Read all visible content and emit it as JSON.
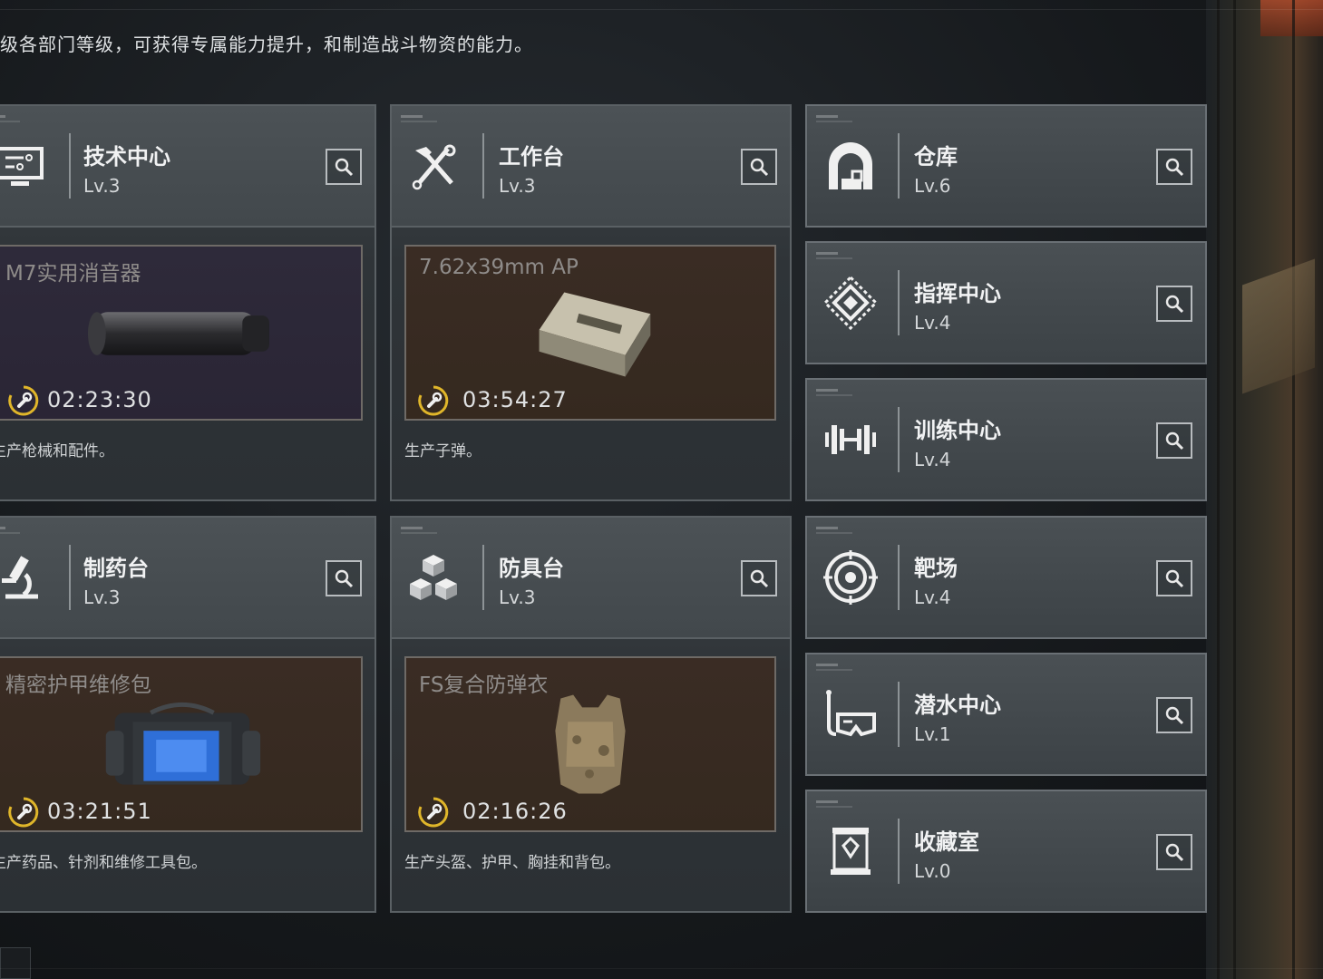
{
  "header": {
    "description": "级各部门等级，可获得专属能力提升，和制造战斗物资的能力。"
  },
  "departments": {
    "tech": {
      "name": "技术中心",
      "level": "Lv.3",
      "icon": "monitor-icon",
      "craft_item": "M7实用消音器",
      "timer": "02:23:30",
      "description": "生产枪械和配件。"
    },
    "workbench": {
      "name": "工作台",
      "level": "Lv.3",
      "icon": "hammer-wrench-icon",
      "craft_item": "7.62x39mm AP",
      "timer": "03:54:27",
      "description": "生产子弹。"
    },
    "pharmacy": {
      "name": "制药台",
      "level": "Lv.3",
      "icon": "microscope-icon",
      "craft_item": "精密护甲维修包",
      "timer": "03:21:51",
      "description": "生产药品、针剂和维修工具包。"
    },
    "armor": {
      "name": "防具台",
      "level": "Lv.3",
      "icon": "cubes-icon",
      "craft_item": "FS复合防弹衣",
      "timer": "02:16:26",
      "description": "生产头盔、护甲、胸挂和背包。"
    },
    "warehouse": {
      "name": "仓库",
      "level": "Lv.6",
      "icon": "warehouse-icon"
    },
    "command": {
      "name": "指挥中心",
      "level": "Lv.4",
      "icon": "diamond-pattern-icon"
    },
    "training": {
      "name": "训练中心",
      "level": "Lv.4",
      "icon": "dumbbell-icon"
    },
    "range": {
      "name": "靶场",
      "level": "Lv.4",
      "icon": "target-icon"
    },
    "diving": {
      "name": "潜水中心",
      "level": "Lv.1",
      "icon": "diving-mask-icon"
    },
    "collection": {
      "name": "收藏室",
      "level": "Lv.0",
      "icon": "display-case-icon"
    }
  },
  "colors": {
    "panel": "#42484c",
    "craft_purple": "#2e2a3a",
    "craft_brown": "#3a2c24",
    "timer_accent": "#e0b62a"
  }
}
